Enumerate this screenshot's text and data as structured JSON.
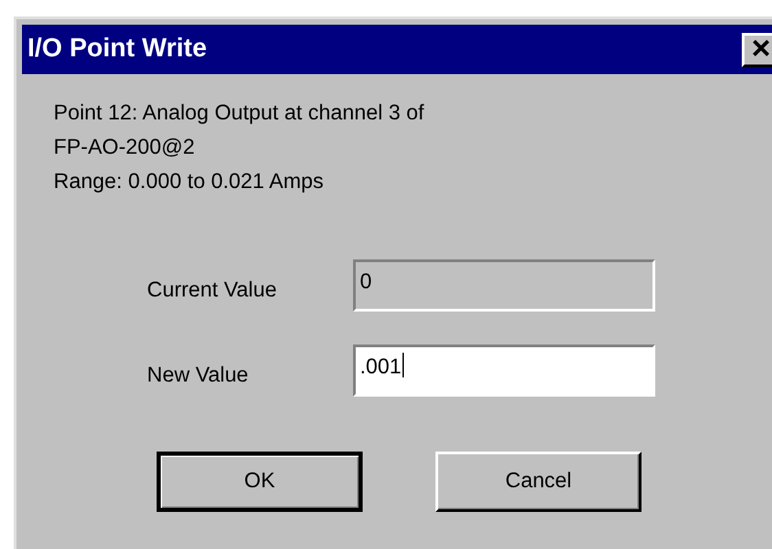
{
  "window": {
    "title": "I/O Point Write",
    "close_glyph": "×"
  },
  "description": [
    "Point 12: Analog Output at channel 3 of",
    "FP-AO-200@2",
    "Range: 0.000 to 0.021 Amps"
  ],
  "fields": [
    {
      "label": "Current Value",
      "value": "0",
      "read_only": true,
      "focused": false
    },
    {
      "label": "New Value",
      "value": ".001",
      "read_only": false,
      "focused": true
    }
  ],
  "buttons": [
    {
      "label": "OK",
      "default": true
    },
    {
      "label": "Cancel",
      "default": false
    }
  ]
}
